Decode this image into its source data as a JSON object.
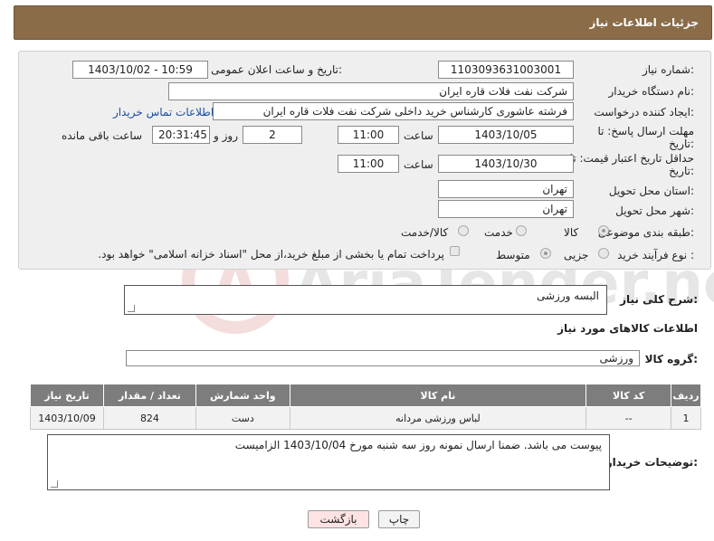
{
  "header": {
    "title": "جزئیات اطلاعات نیاز"
  },
  "fields": {
    "need_number_label": "شماره نیاز:",
    "need_number_value": "1103093631003001",
    "announce_label": "تاریخ و ساعت اعلان عمومی:",
    "announce_value": "1403/10/02 - 10:59",
    "buyer_org_label": "نام دستگاه خریدار:",
    "buyer_org_value": "شرکت نفت فلات قاره ایران",
    "requester_label": "ایجاد کننده درخواست:",
    "requester_value": "فرشته عاشوری کارشناس خرید داخلی  شرکت نفت فلات قاره ایران",
    "contact_link": "اطلاعات تماس خریدار",
    "reply_deadline_label_1": "مهلت ارسال پاسخ: تا",
    "reply_deadline_label_2": "تاریخ:",
    "reply_date": "1403/10/05",
    "time_label": "ساعت",
    "reply_time": "11:00",
    "days_value": "2",
    "days_label": "روز و",
    "remaining_value": "20:31:45",
    "remaining_label": "ساعت باقی مانده",
    "price_validity_label_1": "حداقل تاریخ اعتبار قیمت: تا",
    "price_validity_label_2": "تاریخ:",
    "validity_date": "1403/10/30",
    "validity_time": "11:00",
    "province_label": "استان محل تحویل:",
    "province_value": "تهران",
    "city_label": "شهر محل تحویل:",
    "city_value": "تهران",
    "category_label": "طبقه بندی موضوعی:",
    "category_options": [
      "کالا",
      "خدمت",
      "کالا/خدمت"
    ],
    "process_label": "نوع فرآیند خرید :",
    "process_options": [
      "جزیی",
      "متوسط"
    ],
    "payment_note": "پرداخت تمام یا بخشی از مبلغ خرید،از محل \"اسناد خزانه اسلامی\" خواهد بود."
  },
  "description": {
    "label": "شرح کلی نیاز:",
    "value": "البسه ورزشی"
  },
  "goods_section_title": "اطلاعات کالاهای مورد نیاز",
  "goods_group": {
    "label": "گروه کالا:",
    "value": "ورزشی"
  },
  "table": {
    "headers": [
      "ردیف",
      "کد کالا",
      "نام کالا",
      "واحد شمارش",
      "تعداد / مقدار",
      "تاریخ نیاز"
    ],
    "rows": [
      [
        "1",
        "--",
        "لباس ورزشی مردانه",
        "دست",
        "824",
        "1403/10/09"
      ]
    ]
  },
  "buyer_notes": {
    "label": "توضیحات خریدار:",
    "value": "پیوست می باشد. ضمنا ارسال نمونه روز سه شنبه مورخ 1403/10/04 الزامیست"
  },
  "buttons": {
    "print": "چاپ",
    "back": "بازگشت"
  },
  "watermark_text": "AriaTender.neT",
  "colors": {
    "header_bg": "#8b6c48",
    "table_header_bg": "#7d7d7d",
    "back_button_bg": "#fde3e3"
  }
}
